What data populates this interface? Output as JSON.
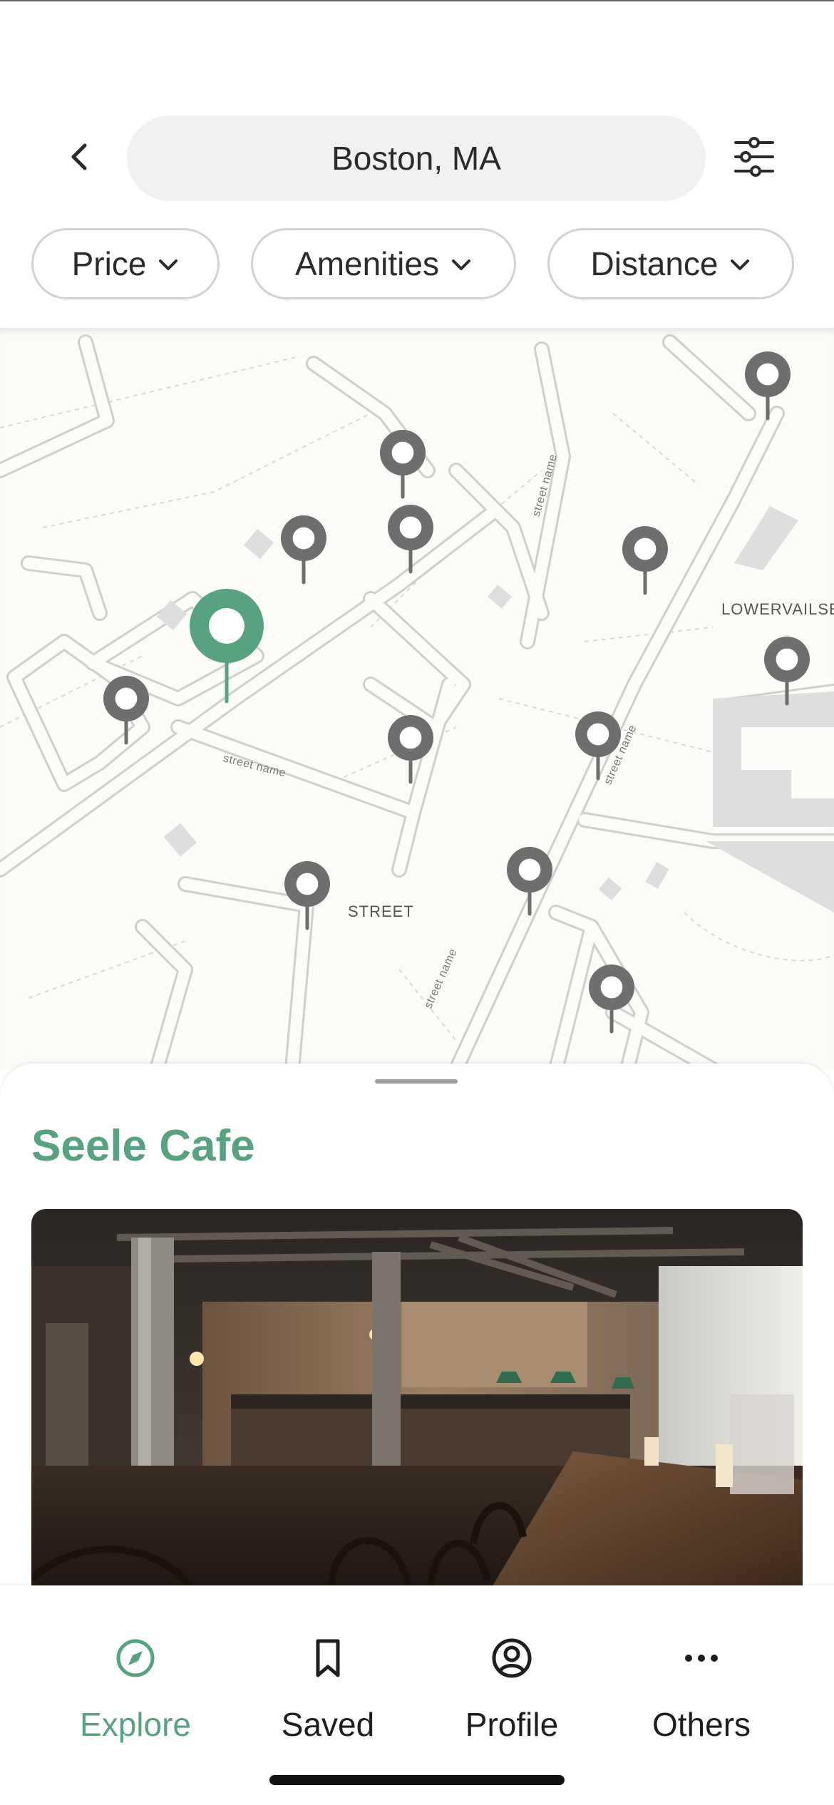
{
  "header": {
    "search_value": "Boston, MA",
    "back_icon": "chevron-left-icon",
    "filter_icon": "sliders-icon"
  },
  "chips": [
    {
      "label": "Price"
    },
    {
      "label": "Amenities"
    },
    {
      "label": "Distance"
    }
  ],
  "map": {
    "labels": {
      "street": "STREET",
      "lowervails": "LOWERVAILSE",
      "street_name_1": "street name",
      "street_name_2": "street name",
      "street_name_3": "street name",
      "street_name_4": "street name"
    },
    "pin_color_selected": "#58a37f",
    "pin_color_default": "#6e6e6e"
  },
  "place": {
    "title": "Seele Cafe"
  },
  "nav": {
    "items": [
      {
        "label": "Explore",
        "icon": "compass-icon",
        "active": true
      },
      {
        "label": "Saved",
        "icon": "bookmark-icon",
        "active": false
      },
      {
        "label": "Profile",
        "icon": "user-circle-icon",
        "active": false
      },
      {
        "label": "Others",
        "icon": "more-horizontal-icon",
        "active": false
      }
    ]
  },
  "colors": {
    "accent": "#58a37f",
    "chip_border": "#d2d2d2",
    "search_bg": "#f1f1f1"
  }
}
